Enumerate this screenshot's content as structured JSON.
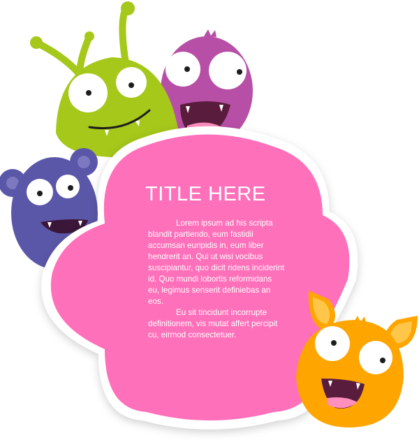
{
  "card": {
    "title": "TITLE HERE",
    "paragraphs": [
      "Lorem ipsum ad his scripta blandit partiendo, eum fastidii accumsan euripidis in, eum liber hendrerit an. Qui ut wisi vocibus suscipiantur, quo dicit ridens inciderint id. Quo mundi lobortis reformidans eu, legimus senserit definiebas an eos.",
      "Eu sit tincidunt incorrupte definitionem, vis mutat affert percipit cu, eirmod consectetuer."
    ]
  },
  "colors": {
    "card_pink": "#ff6fba",
    "green_monster": "#a5c81a",
    "purple_monster": "#b84fa6",
    "blue_monster": "#5b57a8",
    "orange_monster": "#ffa500"
  },
  "illustrations": [
    "green-monster-icon",
    "purple-monster-icon",
    "blue-monster-icon",
    "orange-monster-icon"
  ]
}
